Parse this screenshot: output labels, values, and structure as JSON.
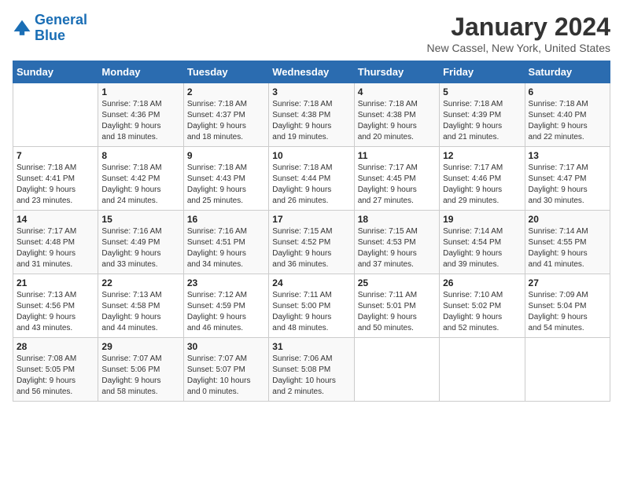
{
  "header": {
    "logo_line1": "General",
    "logo_line2": "Blue",
    "title": "January 2024",
    "subtitle": "New Cassel, New York, United States"
  },
  "weekdays": [
    "Sunday",
    "Monday",
    "Tuesday",
    "Wednesday",
    "Thursday",
    "Friday",
    "Saturday"
  ],
  "weeks": [
    [
      {
        "day": "",
        "info": ""
      },
      {
        "day": "1",
        "info": "Sunrise: 7:18 AM\nSunset: 4:36 PM\nDaylight: 9 hours\nand 18 minutes."
      },
      {
        "day": "2",
        "info": "Sunrise: 7:18 AM\nSunset: 4:37 PM\nDaylight: 9 hours\nand 18 minutes."
      },
      {
        "day": "3",
        "info": "Sunrise: 7:18 AM\nSunset: 4:38 PM\nDaylight: 9 hours\nand 19 minutes."
      },
      {
        "day": "4",
        "info": "Sunrise: 7:18 AM\nSunset: 4:38 PM\nDaylight: 9 hours\nand 20 minutes."
      },
      {
        "day": "5",
        "info": "Sunrise: 7:18 AM\nSunset: 4:39 PM\nDaylight: 9 hours\nand 21 minutes."
      },
      {
        "day": "6",
        "info": "Sunrise: 7:18 AM\nSunset: 4:40 PM\nDaylight: 9 hours\nand 22 minutes."
      }
    ],
    [
      {
        "day": "7",
        "info": "Sunrise: 7:18 AM\nSunset: 4:41 PM\nDaylight: 9 hours\nand 23 minutes."
      },
      {
        "day": "8",
        "info": "Sunrise: 7:18 AM\nSunset: 4:42 PM\nDaylight: 9 hours\nand 24 minutes."
      },
      {
        "day": "9",
        "info": "Sunrise: 7:18 AM\nSunset: 4:43 PM\nDaylight: 9 hours\nand 25 minutes."
      },
      {
        "day": "10",
        "info": "Sunrise: 7:18 AM\nSunset: 4:44 PM\nDaylight: 9 hours\nand 26 minutes."
      },
      {
        "day": "11",
        "info": "Sunrise: 7:17 AM\nSunset: 4:45 PM\nDaylight: 9 hours\nand 27 minutes."
      },
      {
        "day": "12",
        "info": "Sunrise: 7:17 AM\nSunset: 4:46 PM\nDaylight: 9 hours\nand 29 minutes."
      },
      {
        "day": "13",
        "info": "Sunrise: 7:17 AM\nSunset: 4:47 PM\nDaylight: 9 hours\nand 30 minutes."
      }
    ],
    [
      {
        "day": "14",
        "info": "Sunrise: 7:17 AM\nSunset: 4:48 PM\nDaylight: 9 hours\nand 31 minutes."
      },
      {
        "day": "15",
        "info": "Sunrise: 7:16 AM\nSunset: 4:49 PM\nDaylight: 9 hours\nand 33 minutes."
      },
      {
        "day": "16",
        "info": "Sunrise: 7:16 AM\nSunset: 4:51 PM\nDaylight: 9 hours\nand 34 minutes."
      },
      {
        "day": "17",
        "info": "Sunrise: 7:15 AM\nSunset: 4:52 PM\nDaylight: 9 hours\nand 36 minutes."
      },
      {
        "day": "18",
        "info": "Sunrise: 7:15 AM\nSunset: 4:53 PM\nDaylight: 9 hours\nand 37 minutes."
      },
      {
        "day": "19",
        "info": "Sunrise: 7:14 AM\nSunset: 4:54 PM\nDaylight: 9 hours\nand 39 minutes."
      },
      {
        "day": "20",
        "info": "Sunrise: 7:14 AM\nSunset: 4:55 PM\nDaylight: 9 hours\nand 41 minutes."
      }
    ],
    [
      {
        "day": "21",
        "info": "Sunrise: 7:13 AM\nSunset: 4:56 PM\nDaylight: 9 hours\nand 43 minutes."
      },
      {
        "day": "22",
        "info": "Sunrise: 7:13 AM\nSunset: 4:58 PM\nDaylight: 9 hours\nand 44 minutes."
      },
      {
        "day": "23",
        "info": "Sunrise: 7:12 AM\nSunset: 4:59 PM\nDaylight: 9 hours\nand 46 minutes."
      },
      {
        "day": "24",
        "info": "Sunrise: 7:11 AM\nSunset: 5:00 PM\nDaylight: 9 hours\nand 48 minutes."
      },
      {
        "day": "25",
        "info": "Sunrise: 7:11 AM\nSunset: 5:01 PM\nDaylight: 9 hours\nand 50 minutes."
      },
      {
        "day": "26",
        "info": "Sunrise: 7:10 AM\nSunset: 5:02 PM\nDaylight: 9 hours\nand 52 minutes."
      },
      {
        "day": "27",
        "info": "Sunrise: 7:09 AM\nSunset: 5:04 PM\nDaylight: 9 hours\nand 54 minutes."
      }
    ],
    [
      {
        "day": "28",
        "info": "Sunrise: 7:08 AM\nSunset: 5:05 PM\nDaylight: 9 hours\nand 56 minutes."
      },
      {
        "day": "29",
        "info": "Sunrise: 7:07 AM\nSunset: 5:06 PM\nDaylight: 9 hours\nand 58 minutes."
      },
      {
        "day": "30",
        "info": "Sunrise: 7:07 AM\nSunset: 5:07 PM\nDaylight: 10 hours\nand 0 minutes."
      },
      {
        "day": "31",
        "info": "Sunrise: 7:06 AM\nSunset: 5:08 PM\nDaylight: 10 hours\nand 2 minutes."
      },
      {
        "day": "",
        "info": ""
      },
      {
        "day": "",
        "info": ""
      },
      {
        "day": "",
        "info": ""
      }
    ]
  ]
}
